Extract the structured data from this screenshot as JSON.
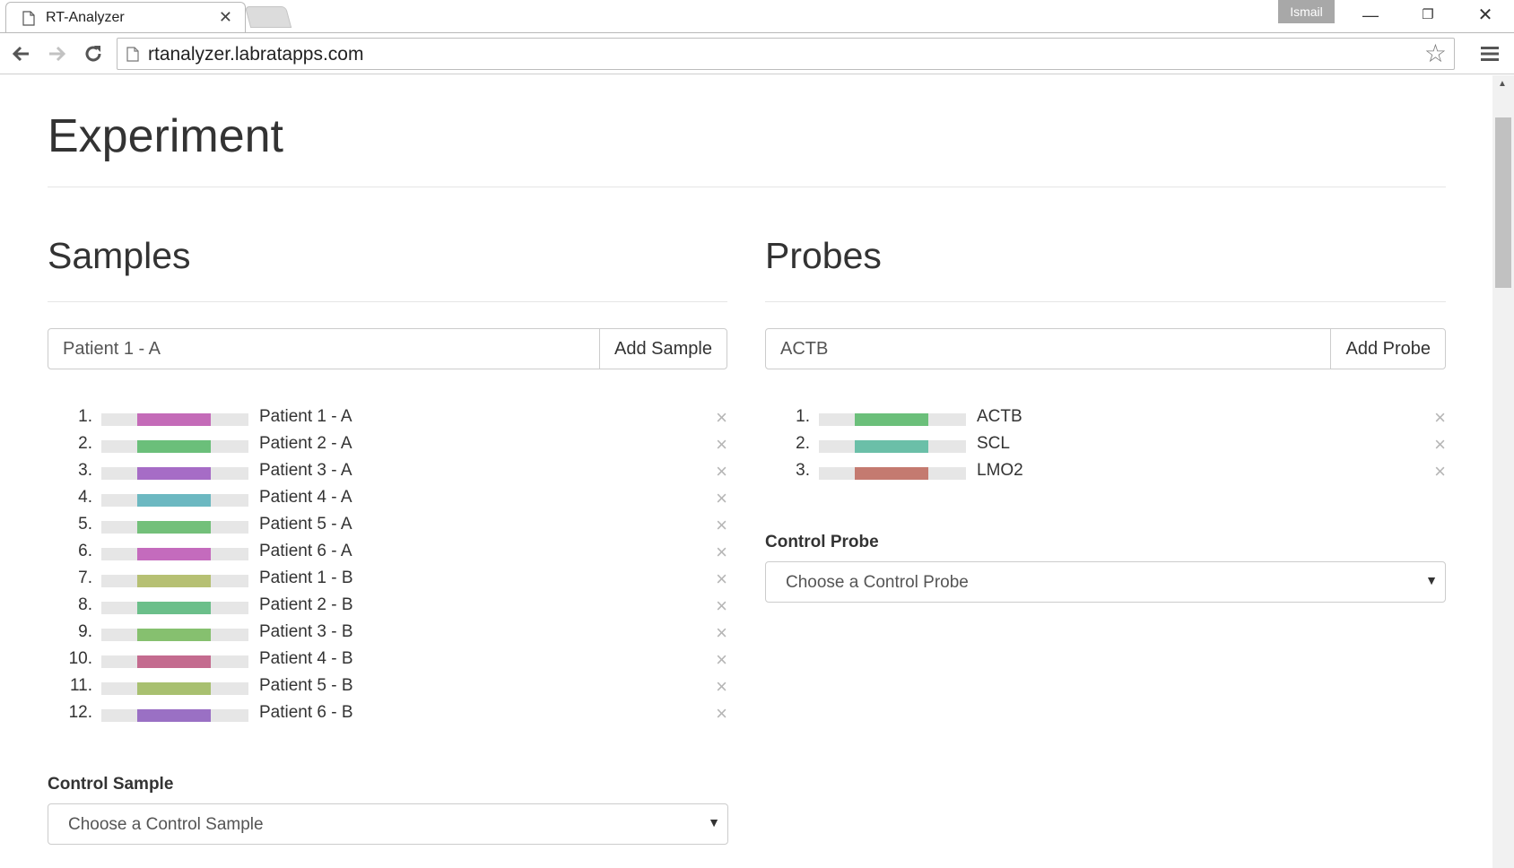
{
  "browser": {
    "tab_title": "RT-Analyzer",
    "url": "rtanalyzer.labratapps.com",
    "profile_name": "Ismail",
    "icons": {
      "back": "arrow-left-icon",
      "forward": "arrow-right-icon",
      "reload": "reload-icon",
      "bookmark": "star-icon",
      "menu": "hamburger-menu-icon",
      "tab_close": "close-icon"
    }
  },
  "page": {
    "title": "Experiment"
  },
  "samples": {
    "heading": "Samples",
    "input_value": "Patient 1 - A",
    "add_button": "Add Sample",
    "items": [
      {
        "num": "1.",
        "label": "Patient 1 - A",
        "color": "#c46bb8"
      },
      {
        "num": "2.",
        "label": "Patient 2 - A",
        "color": "#6bbf7a"
      },
      {
        "num": "3.",
        "label": "Patient 3 - A",
        "color": "#a66cc6"
      },
      {
        "num": "4.",
        "label": "Patient 4 - A",
        "color": "#6cb8c1"
      },
      {
        "num": "5.",
        "label": "Patient 5 - A",
        "color": "#73c07a"
      },
      {
        "num": "6.",
        "label": "Patient 6 - A",
        "color": "#c46bbd"
      },
      {
        "num": "7.",
        "label": "Patient 1 - B",
        "color": "#b6c073"
      },
      {
        "num": "8.",
        "label": "Patient 2 - B",
        "color": "#6bbf8a"
      },
      {
        "num": "9.",
        "label": "Patient 3 - B",
        "color": "#86c06f"
      },
      {
        "num": "10.",
        "label": "Patient 4 - B",
        "color": "#c46b8f"
      },
      {
        "num": "11.",
        "label": "Patient 5 - B",
        "color": "#a8c070"
      },
      {
        "num": "12.",
        "label": "Patient 6 - B",
        "color": "#9a70c4"
      }
    ],
    "control_label": "Control Sample",
    "control_placeholder": "Choose a Control Sample"
  },
  "probes": {
    "heading": "Probes",
    "input_value": "ACTB",
    "add_button": "Add Probe",
    "items": [
      {
        "num": "1.",
        "label": "ACTB",
        "color": "#6bbf7a"
      },
      {
        "num": "2.",
        "label": "SCL",
        "color": "#6bbfa8"
      },
      {
        "num": "3.",
        "label": "LMO2",
        "color": "#c47a70"
      }
    ],
    "control_label": "Control Probe",
    "control_placeholder": "Choose a Control Probe"
  },
  "glyphs": {
    "remove": "×",
    "caret": "▼",
    "minimize": "—",
    "maximize": "❐",
    "close": "✕"
  }
}
